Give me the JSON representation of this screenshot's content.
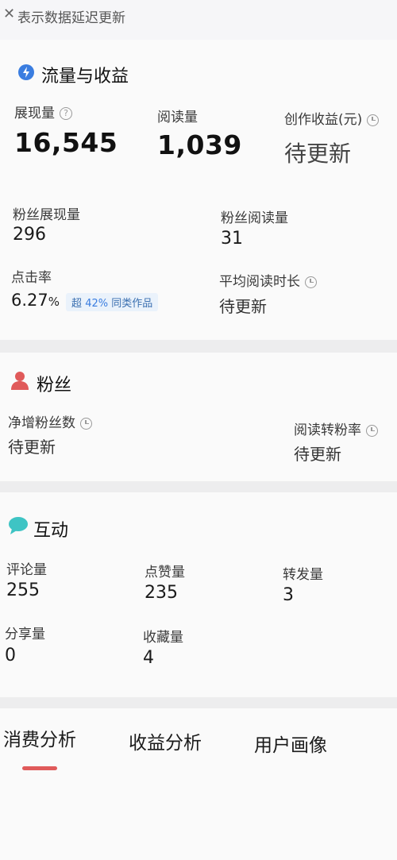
{
  "top_notice": {
    "icon": "close-icon",
    "text": "表示数据延迟更新"
  },
  "traffic": {
    "title": "流量与收益",
    "icon": "drop-icon",
    "impressions": {
      "label": "展现量",
      "value": "16,545"
    },
    "reads": {
      "label": "阅读量",
      "value": "1,039"
    },
    "earnings": {
      "label": "创作收益(元)",
      "value": "待更新"
    },
    "fan_impressions": {
      "label": "粉丝展现量",
      "value": "296"
    },
    "fan_reads": {
      "label": "粉丝阅读量",
      "value": "31"
    },
    "ctr": {
      "label": "点击率",
      "value": "6.27",
      "unit": "%",
      "badge_prefix": "超",
      "badge_pct": "42%",
      "badge_suffix": "同类作品"
    },
    "avg_read_time": {
      "label": "平均阅读时长",
      "value": "待更新"
    }
  },
  "fans": {
    "title": "粉丝",
    "icon": "person-icon",
    "net_growth": {
      "label": "净增粉丝数",
      "value": "待更新"
    },
    "conversion": {
      "label": "阅读转粉率",
      "value": "待更新"
    }
  },
  "interaction": {
    "title": "互动",
    "icon": "chat-bubble-icon",
    "comments": {
      "label": "评论量",
      "value": "255"
    },
    "likes": {
      "label": "点赞量",
      "value": "235"
    },
    "reposts": {
      "label": "转发量",
      "value": "3"
    },
    "shares": {
      "label": "分享量",
      "value": "0"
    },
    "favorites": {
      "label": "收藏量",
      "value": "4"
    }
  },
  "tabs": [
    {
      "label": "消费分析",
      "active": true
    },
    {
      "label": "收益分析",
      "active": false
    },
    {
      "label": "用户画像",
      "active": false
    }
  ],
  "colors": {
    "accent_blue": "#3a7de0",
    "fans_red": "#e05a5a",
    "interact_teal": "#3ec4c4",
    "tab_underline": "#e05a5a"
  }
}
